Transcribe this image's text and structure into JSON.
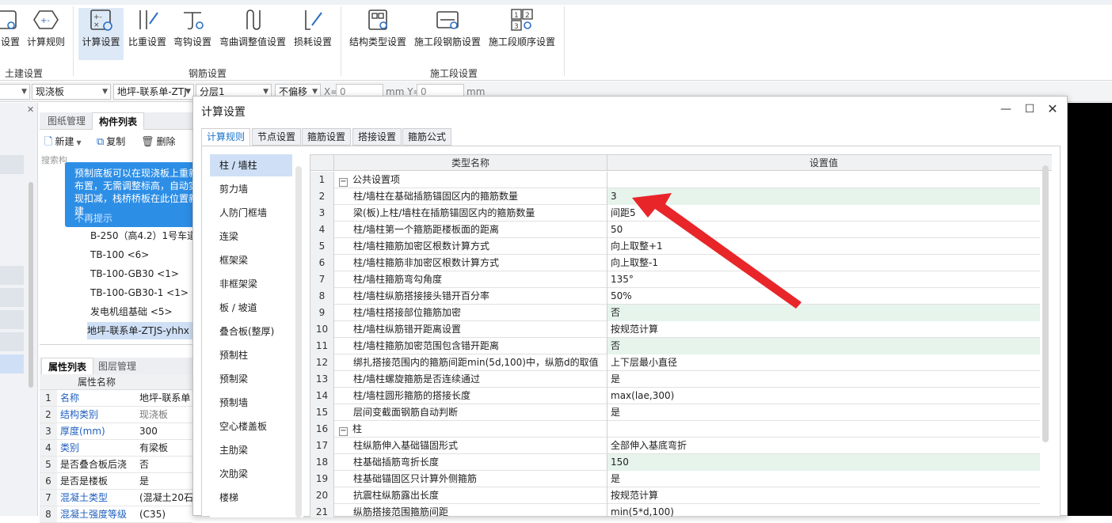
{
  "ribbon": {
    "buttons": [
      {
        "label": "设置",
        "icon": "settings-icon"
      },
      {
        "label": "计算规则",
        "icon": "calc-rule-icon"
      },
      {
        "label": "计算设置",
        "icon": "calc-settings-icon"
      },
      {
        "label": "比重设置",
        "icon": "density-settings-icon"
      },
      {
        "label": "弯钩设置",
        "icon": "hook-settings-icon"
      },
      {
        "label": "弯曲调整值设置",
        "icon": "bend-adjust-icon"
      },
      {
        "label": "损耗设置",
        "icon": "loss-settings-icon"
      },
      {
        "label": "结构类型设置",
        "icon": "structure-type-icon"
      },
      {
        "label": "施工段钢筋设置",
        "icon": "segment-rebar-icon"
      },
      {
        "label": "施工段顺序设置",
        "icon": "segment-order-icon"
      }
    ],
    "groups": [
      "土建设置",
      "钢筋设置",
      "施工段设置"
    ]
  },
  "toolbar2": {
    "combo1": "现浇板",
    "combo2": "地坪-联系单-ZTJ",
    "combo3": "分层1",
    "combo4": "不偏移",
    "x_label": "X=",
    "x_value": "0",
    "mm_y_label": "mm Y=",
    "y_value": "0",
    "mm_label": "mm"
  },
  "leftpane": {
    "tabs": [
      "图纸管理",
      "构件列表"
    ],
    "tools": [
      "新建",
      "复制",
      "删除"
    ],
    "search_placeholder": "搜索构",
    "tooltip_text": "预制底板可以在现浇板上重新布置，无需调整标高，自动实现扣减，栈桥桥板在此位置新建",
    "tooltip_dismiss": "不再提示",
    "tree": [
      "B-250（高4.2）1号车道",
      "TB-100 <6>",
      "TB-100-GB30 <1>",
      "TB-100-GB30-1 <1>",
      "发电机组基础 <5>",
      "地坪-联系单-ZTJS-yhhx"
    ]
  },
  "props": {
    "tabs": [
      "属性列表",
      "图层管理"
    ],
    "header": "属性名称",
    "rows": [
      {
        "n": "1",
        "k": "名称",
        "v": "地坪-联系单"
      },
      {
        "n": "2",
        "k": "结构类别",
        "v": "现浇板"
      },
      {
        "n": "3",
        "k": "厚度(mm)",
        "v": "300"
      },
      {
        "n": "4",
        "k": "类别",
        "v": "有梁板"
      },
      {
        "n": "5",
        "k": "是否叠合板后浇",
        "v": "否"
      },
      {
        "n": "6",
        "k": "是否是楼板",
        "v": "是"
      },
      {
        "n": "7",
        "k": "混凝土类型",
        "v": "(混凝土20石"
      },
      {
        "n": "8",
        "k": "混凝土强度等级",
        "v": "(C35)"
      }
    ]
  },
  "dialog": {
    "title": "计算设置",
    "tabs": [
      "计算规则",
      "节点设置",
      "箍筋设置",
      "搭接设置",
      "箍筋公式"
    ],
    "categories": [
      "柱 / 墙柱",
      "剪力墙",
      "人防门框墙",
      "连梁",
      "框架梁",
      "非框架梁",
      "板 / 坡道",
      "叠合板(整厚)",
      "预制柱",
      "预制梁",
      "预制墙",
      "空心楼盖板",
      "主肋梁",
      "次肋梁",
      "楼梯"
    ],
    "grid_header_name": "类型名称",
    "grid_header_value": "设置值",
    "rows": [
      {
        "n": "1",
        "name": "公共设置项",
        "value": "",
        "group": true,
        "hl": false
      },
      {
        "n": "2",
        "name": "柱/墙柱在基础插筋锚固区内的箍筋数量",
        "value": "3",
        "group": false,
        "hl": true
      },
      {
        "n": "3",
        "name": "梁(板)上柱/墙柱在插筋锚固区内的箍筋数量",
        "value": "间距5",
        "group": false,
        "hl": false
      },
      {
        "n": "4",
        "name": "柱/墙柱第一个箍筋距楼板面的距离",
        "value": "50",
        "group": false,
        "hl": false
      },
      {
        "n": "5",
        "name": "柱/墙柱箍筋加密区根数计算方式",
        "value": "向上取整+1",
        "group": false,
        "hl": false
      },
      {
        "n": "6",
        "name": "柱/墙柱箍筋非加密区根数计算方式",
        "value": "向上取整-1",
        "group": false,
        "hl": false
      },
      {
        "n": "7",
        "name": "柱/墙柱箍筋弯勾角度",
        "value": "135°",
        "group": false,
        "hl": false
      },
      {
        "n": "8",
        "name": "柱/墙柱纵筋搭接接头错开百分率",
        "value": "50%",
        "group": false,
        "hl": false
      },
      {
        "n": "9",
        "name": "柱/墙柱搭接部位箍筋加密",
        "value": "否",
        "group": false,
        "hl": true
      },
      {
        "n": "10",
        "name": "柱/墙柱纵筋错开距离设置",
        "value": "按规范计算",
        "group": false,
        "hl": false
      },
      {
        "n": "11",
        "name": "柱/墙柱箍筋加密范围包含错开距离",
        "value": "否",
        "group": false,
        "hl": true
      },
      {
        "n": "12",
        "name": "绑扎搭接范围内的箍筋间距min(5d,100)中，纵筋d的取值",
        "value": "上下层最小直径",
        "group": false,
        "hl": false
      },
      {
        "n": "13",
        "name": "柱/墙柱螺旋箍筋是否连续通过",
        "value": "是",
        "group": false,
        "hl": false
      },
      {
        "n": "14",
        "name": "柱/墙柱圆形箍筋的搭接长度",
        "value": "max(lae,300)",
        "group": false,
        "hl": false
      },
      {
        "n": "15",
        "name": "层间变截面钢筋自动判断",
        "value": "是",
        "group": false,
        "hl": false
      },
      {
        "n": "16",
        "name": "柱",
        "value": "",
        "group": true,
        "hl": false
      },
      {
        "n": "17",
        "name": "柱纵筋伸入基础锚固形式",
        "value": "全部伸入基底弯折",
        "group": false,
        "hl": false
      },
      {
        "n": "18",
        "name": "柱基础插筋弯折长度",
        "value": "150",
        "group": false,
        "hl": true
      },
      {
        "n": "19",
        "name": "柱基础锚固区只计算外侧箍筋",
        "value": "是",
        "group": false,
        "hl": false
      },
      {
        "n": "20",
        "name": "抗震柱纵筋露出长度",
        "value": "按规范计算",
        "group": false,
        "hl": false
      },
      {
        "n": "21",
        "name": "纵筋搭接范围箍筋间距",
        "value": "min(5*d,100)",
        "group": false,
        "hl": false
      }
    ]
  },
  "colors": {
    "accent": "#1a73c9",
    "arrow": "#e8262a",
    "highlight_row": "#e6f4ec"
  }
}
